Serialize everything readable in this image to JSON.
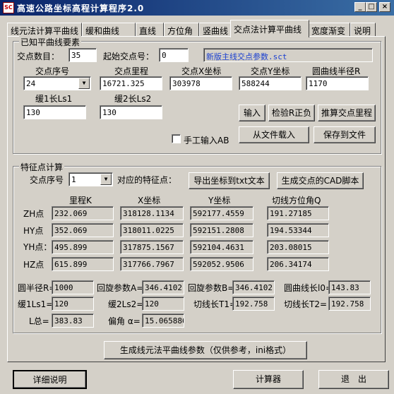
{
  "window": {
    "title": "高速公路坐标高程计算程序2.0",
    "icon": "app-icon",
    "icon_text": "SC",
    "minimize": "_",
    "maximize": "□",
    "close": "×"
  },
  "tabs": [
    "线元法计算平曲线",
    "缓和曲线",
    "直线",
    "方位角",
    "竖曲线",
    "交点法计算平曲线",
    "宽度渐变",
    "说明"
  ],
  "known": {
    "title": "已知平曲线要素",
    "count_label": "交点数目：",
    "count": "35",
    "start_label": "起始交点号：",
    "start": "0",
    "file": "新版主线交点参数.sct",
    "headers": [
      "交点序号",
      "交点里程",
      "交点X坐标",
      "交点Y坐标",
      "圆曲线半径R"
    ],
    "ip_no": "24",
    "ip_station": "16721.325",
    "ip_x": "303978",
    "ip_y": "588244",
    "radius": "1170",
    "ls1_label": "缓1长Ls1",
    "ls2_label": "缓2长Ls2",
    "ls1": "130",
    "ls2": "130",
    "btn_input": "输入",
    "btn_check": "检验R正负",
    "btn_calc_station": "推算交点里程",
    "manual_label": "手工输入AB",
    "manual_checked": false,
    "btn_load": "从文件载入",
    "btn_save": "保存到文件"
  },
  "feature": {
    "title": "特征点计算",
    "ip_label": "交点序号",
    "ip_value": "1",
    "corr_label": "对应的特征点：",
    "btn_export": "导出坐标到txt文本",
    "btn_cad": "生成交点的CAD脚本",
    "headers": [
      "里程K",
      "X坐标",
      "Y坐标",
      "切线方位角Q"
    ],
    "rows": [
      {
        "name": "ZH点",
        "k": "232.069",
        "x": "318128.1134",
        "y": "592177.4559",
        "q": "191.27185"
      },
      {
        "name": "HY点",
        "k": "352.069",
        "x": "318011.0225",
        "y": "592151.2808",
        "q": "194.53344"
      },
      {
        "name": "YH点：",
        "k": "495.899",
        "x": "317875.1567",
        "y": "592104.4631",
        "q": "203.08015"
      },
      {
        "name": "HZ点",
        "k": "615.899",
        "x": "317766.7967",
        "y": "592052.9506",
        "q": "206.34174"
      }
    ],
    "r_label": "圆半径R=",
    "r": "1000",
    "a_label": "回旋参数A=",
    "a": "346.4102",
    "b_label": "回旋参数B=",
    "b": "346.4102",
    "l0_label": "圆曲线长l0=",
    "l0": "143.83",
    "ls1_label": "缓1Ls1=",
    "ls1": "120",
    "ls2_label": "缓2Ls2=",
    "ls2": "120",
    "t1_label": "切线长T1=",
    "t1": "192.758",
    "t2_label": "切线长T2=",
    "t2": "192.758",
    "l_label": "L总=",
    "l": "383.83",
    "alpha_label": "偏角 α=",
    "alpha": "15.065886"
  },
  "btn_generate": "生成线元法平曲线参数（仅供参考，ini格式）",
  "footer": {
    "btn_help": "详细说明",
    "btn_calc": "计算器",
    "btn_exit": "退　出"
  }
}
